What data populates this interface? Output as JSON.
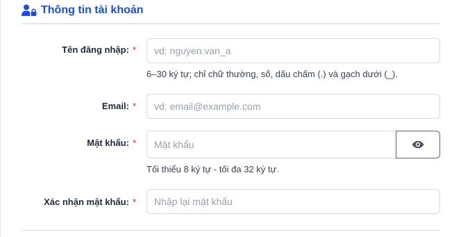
{
  "section": {
    "title": "Thông tin tài khoản",
    "icon": "user-lock-icon",
    "accent_color": "#1d4ed8"
  },
  "fields": {
    "username": {
      "label": "Tên đăng nhập:",
      "required_mark": "*",
      "placeholder": "vd: nguyen.van_a",
      "value": "",
      "hint": "6–30 ký tự; chỉ chữ thường, số, dấu chấm (.) và gạch dưới (_)."
    },
    "email": {
      "label": "Email:",
      "required_mark": "*",
      "placeholder": "vd: email@example.com",
      "value": ""
    },
    "password": {
      "label": "Mật khẩu:",
      "required_mark": "*",
      "placeholder": "Mật khẩu",
      "value": "",
      "toggle_icon": "eye-icon",
      "hint": "Tối thiểu 8 ký tự - tối đa 32 ký tự."
    },
    "confirm_password": {
      "label": "Xác nhận mật khẩu:",
      "required_mark": "*",
      "placeholder": "Nhập lại mật khẩu",
      "value": ""
    }
  },
  "colors": {
    "required": "#dc2626",
    "label": "#1f2937",
    "border": "#d6d9df"
  }
}
